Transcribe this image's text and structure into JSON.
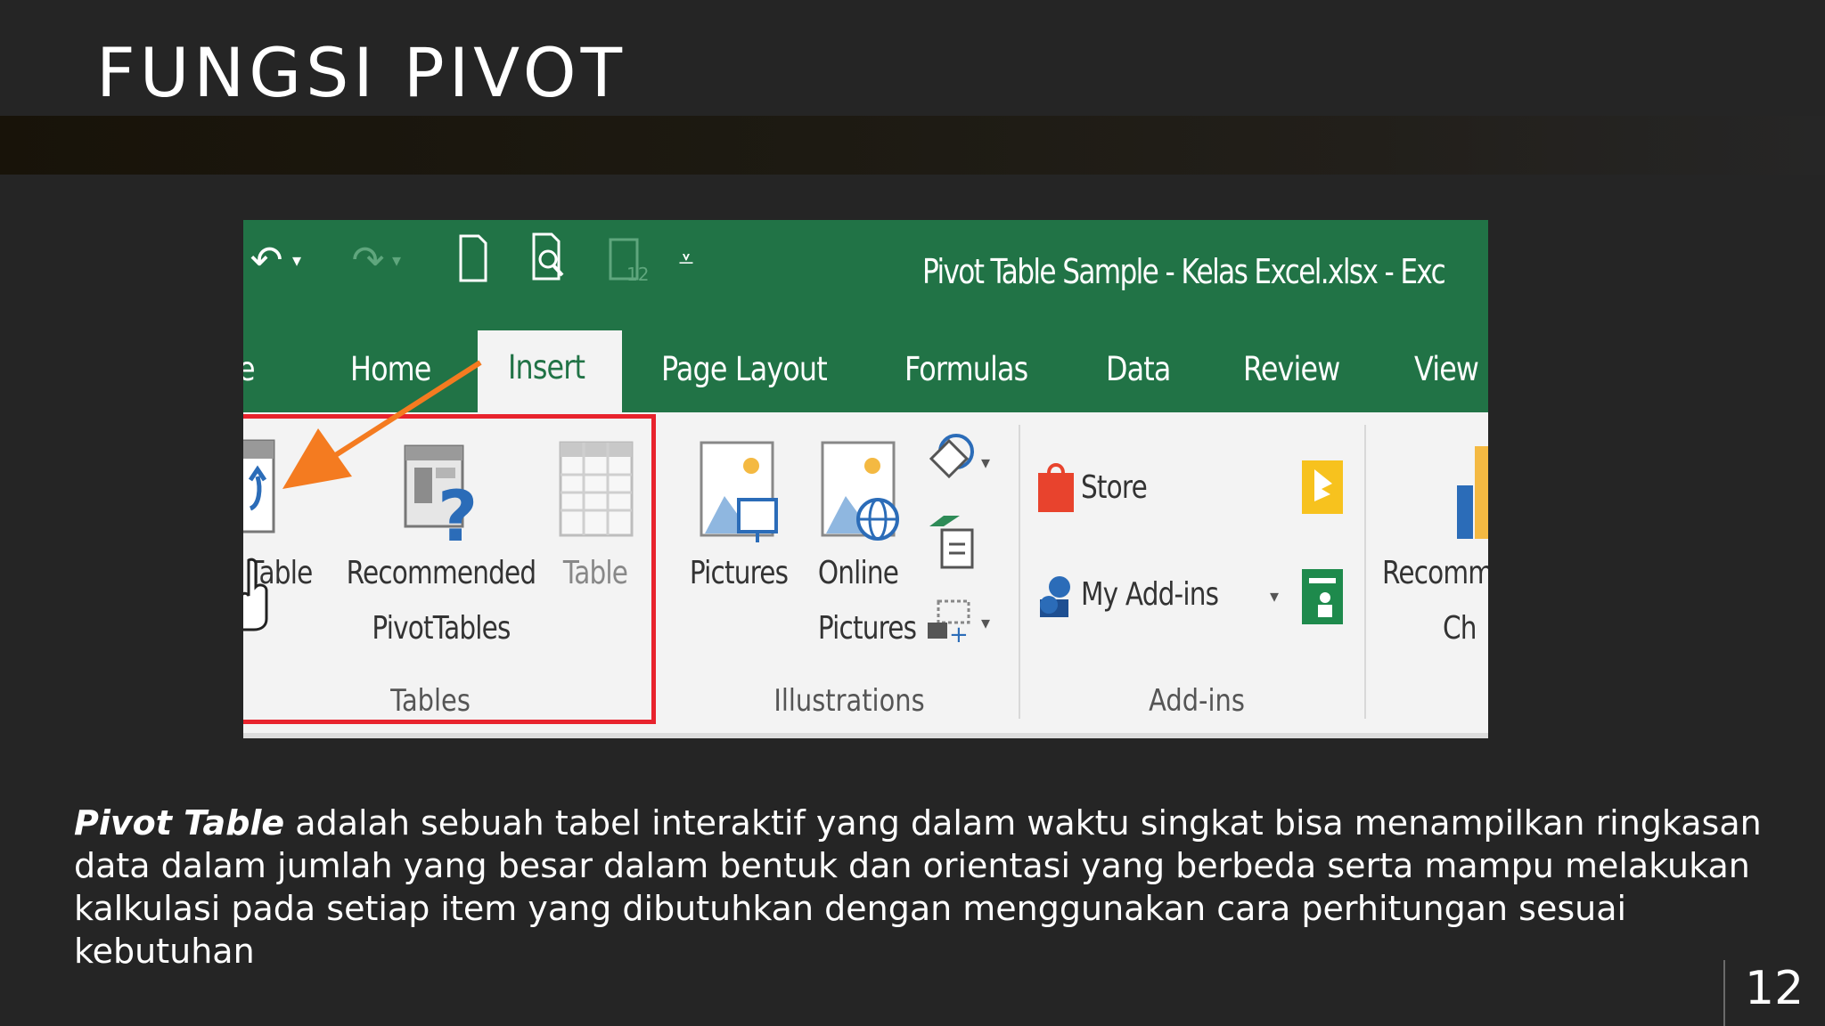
{
  "slide": {
    "title": "FUNGSI PIVOT",
    "page_number": "12",
    "body_bold": "Pivot Table",
    "body_rest": " adalah sebuah tabel interaktif yang dalam waktu singkat bisa menampilkan ringkasan data dalam jumlah yang besar dalam bentuk dan orientasi yang berbeda serta mampu melakukan kalkulasi pada setiap item yang dibutuhkan dengan menggunakan cara perhitungan sesuai kebutuhan"
  },
  "excel": {
    "window_title": "Pivot Table Sample - Kelas Excel.xlsx - Exc",
    "quick_access": [
      "undo-icon",
      "redo-icon",
      "new-file-icon",
      "print-preview-icon",
      "touch-mode-icon",
      "customize-icon"
    ],
    "tabs": {
      "cut": "e",
      "home": "Home",
      "insert": "Insert",
      "page_layout": "Page Layout",
      "formulas": "Formulas",
      "data": "Data",
      "review": "Review",
      "view": "View"
    },
    "ribbon": {
      "pivot_table_label": "Table",
      "recommended_line1": "Recommended",
      "recommended_line2": "PivotTables",
      "table_label": "Table",
      "pictures_label": "Pictures",
      "online_line1": "Online",
      "online_line2": "Pictures",
      "store_label": "Store",
      "addins_label": "My Add-ins",
      "recommended_charts_line1": "Recomm",
      "recommended_charts_line2": "Ch",
      "group_tables": "Tables",
      "group_illustrations": "Illustrations",
      "group_addins": "Add-ins"
    },
    "colors": {
      "excel_green": "#217346",
      "highlight_red": "#e8232d",
      "arrow_orange": "#f47b20",
      "ribbon_bg": "#f3f3f3"
    }
  }
}
